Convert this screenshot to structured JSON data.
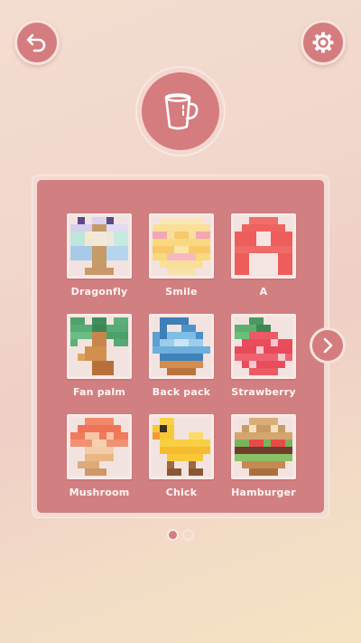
{
  "header": {
    "back_icon": "back-arrow-icon",
    "settings_icon": "gear-icon",
    "category_icon": "cup-icon"
  },
  "puzzles": [
    {
      "name": "Dragonfly"
    },
    {
      "name": "Smile"
    },
    {
      "name": "A"
    },
    {
      "name": "Fan palm"
    },
    {
      "name": "Back pack"
    },
    {
      "name": "Strawberry"
    },
    {
      "name": "Mushroom"
    },
    {
      "name": "Chick"
    },
    {
      "name": "Hamburger"
    }
  ],
  "pagination": {
    "current_page": 1,
    "total_pages": 2
  },
  "colors": {
    "accent": "#d57c7f",
    "panel": "#d27f82",
    "thumb_bg": "#f6e6e2"
  }
}
